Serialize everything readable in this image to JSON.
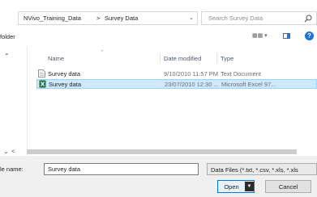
{
  "address": {
    "crumbs": [
      "NVivo_Training_Data",
      "Survey Data"
    ],
    "separator": ">",
    "dropdown_icon": "chevron-down-icon",
    "refresh_icon": "refresh-icon"
  },
  "search": {
    "placeholder": "Search Survey Data",
    "icon": "search-icon"
  },
  "toolbar": {
    "folder_label": "folder",
    "view_icon": "view-options-icon",
    "preview_icon": "preview-pane-icon",
    "help_label": "?"
  },
  "columns": {
    "name": "Name",
    "date": "Date modified",
    "type": "Type"
  },
  "files": [
    {
      "name": "Survey data",
      "date": "9/10/2010 11:57 PM",
      "type": "Text Document",
      "icon": "text-file-icon",
      "selected": false
    },
    {
      "name": "Survey data",
      "date": "23/07/2010 12:30 ...",
      "type": "Microsoft Excel 97...",
      "icon": "excel-file-icon",
      "selected": true
    }
  ],
  "bottom": {
    "file_name_label": "le name:",
    "file_name_value": "Survey data",
    "file_type": "Data Files (*.txt, *.csv, *.xls, *.xls",
    "open_label": "Open",
    "cancel_label": "Cancel"
  }
}
